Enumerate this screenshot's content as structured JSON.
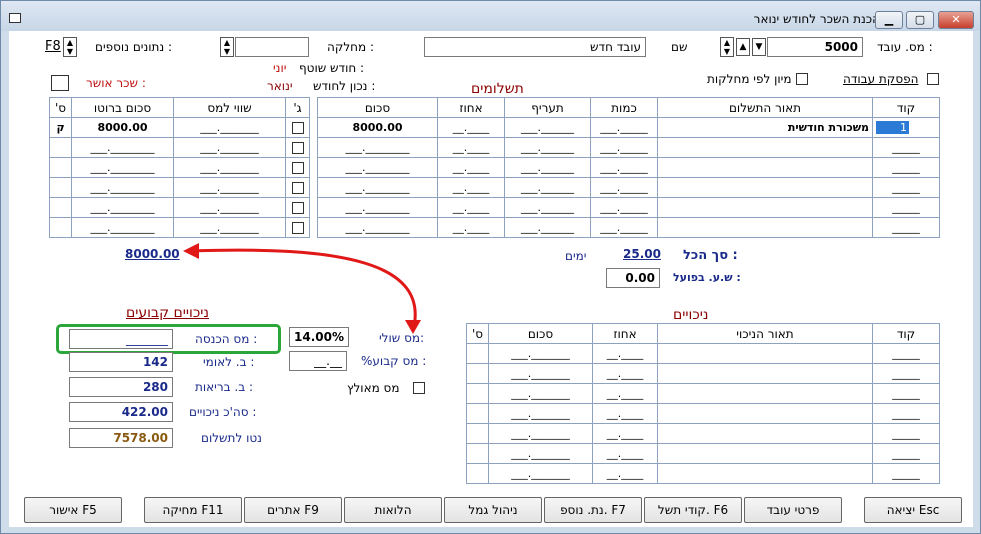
{
  "window": {
    "title": "הכנת השכר לחודש ינואר"
  },
  "header": {
    "employee_no_label": "מס. עובד :",
    "employee_no_value": "5000",
    "name_label": "שם",
    "name_value": "עובד חדש",
    "department_label": "מחלקה :",
    "department_value": "",
    "extra_data_label": "נתונים נוספים :",
    "extra_data_key": "F8",
    "current_month_label": "חודש שוטף :",
    "current_month_value": "יוני",
    "valid_month_label": "נכון לחודש :",
    "valid_month_value": "ינואר",
    "approved_salary_label": "שכר אושר :",
    "work_stop_label": "הפסקת עבודה",
    "sort_by_dept_label": "מיון לפי מחלקות"
  },
  "payments": {
    "section_title": "תשלומים",
    "columns": [
      "קוד",
      "תאור התשלום",
      "כמות",
      "תעריף",
      "אחוז",
      "סכום"
    ],
    "rows": [
      {
        "code": "1",
        "desc": "משכורת חודשית",
        "qty": "_____.___",
        "rate": "______.___",
        "pct": "____.__",
        "amount": "8000.00"
      },
      {
        "code": "_____",
        "desc": "",
        "qty": "_____.___",
        "rate": "______.___",
        "pct": "____.__",
        "amount": "________.___"
      },
      {
        "code": "_____",
        "desc": "",
        "qty": "_____.___",
        "rate": "______.___",
        "pct": "____.__",
        "amount": "________.___"
      },
      {
        "code": "_____",
        "desc": "",
        "qty": "_____.___",
        "rate": "______.___",
        "pct": "____.__",
        "amount": "________.___"
      },
      {
        "code": "_____",
        "desc": "",
        "qty": "_____.___",
        "rate": "______.___",
        "pct": "____.__",
        "amount": "________.___"
      },
      {
        "code": "_____",
        "desc": "",
        "qty": "_____.___",
        "rate": "______.___",
        "pct": "____.__",
        "amount": "________.___"
      }
    ],
    "side_columns": [
      "ג'",
      "שווי למס",
      "סכום ברוטו",
      "ס'"
    ],
    "side_rows": [
      {
        "tax_value": "_______.___",
        "gross": "8000.00",
        "s": "ק"
      },
      {
        "tax_value": "_______.___",
        "gross": "________.___",
        "s": ""
      },
      {
        "tax_value": "_______.___",
        "gross": "________.___",
        "s": ""
      },
      {
        "tax_value": "_______.___",
        "gross": "________.___",
        "s": ""
      },
      {
        "tax_value": "_______.___",
        "gross": "________.___",
        "s": ""
      },
      {
        "tax_value": "_______.___",
        "gross": "________.___",
        "s": ""
      }
    ],
    "gross_total": "8000.00",
    "total_label": "סך הכל :",
    "total_value": "25.00",
    "days_label": "ימים",
    "actual_hours_label": "ש.ע. בפועל :",
    "actual_hours_value": "0.00"
  },
  "fixed_deductions": {
    "title": "ניכויים קבועים",
    "income_tax_label": "מס הכנסה :",
    "income_tax_value": "_______",
    "national_ins_label": "ב. לאומי :",
    "national_ins_value": "142",
    "health_ins_label": "ב. בריאות :",
    "health_ins_value": "280",
    "total_deductions_label": "סה'כ ניכויים :",
    "total_deductions_value": "422.00",
    "net_label": "נטו לתשלום",
    "net_value": "7578.00"
  },
  "tax": {
    "marginal_label": "מס שולי:",
    "marginal_value": "14.00%",
    "fixed_label": "%מס קבוע :",
    "fixed_value": "__.__",
    "forced_label": "מס מאולץ"
  },
  "deductions": {
    "title": "ניכויים",
    "columns": [
      "קוד",
      "תאור הניכוי",
      "אחוז",
      "סכום",
      "ס'"
    ],
    "rows": [
      {
        "code": "_____",
        "desc": "",
        "pct": "____.__",
        "amount": "_______.___",
        "s": ""
      },
      {
        "code": "_____",
        "desc": "",
        "pct": "____.__",
        "amount": "_______.___",
        "s": ""
      },
      {
        "code": "_____",
        "desc": "",
        "pct": "____.__",
        "amount": "_______.___",
        "s": ""
      },
      {
        "code": "_____",
        "desc": "",
        "pct": "____.__",
        "amount": "_______.___",
        "s": ""
      },
      {
        "code": "_____",
        "desc": "",
        "pct": "____.__",
        "amount": "_______.___",
        "s": ""
      },
      {
        "code": "_____",
        "desc": "",
        "pct": "____.__",
        "amount": "_______.___",
        "s": ""
      },
      {
        "code": "_____",
        "desc": "",
        "pct": "____.__",
        "amount": "_______.___",
        "s": ""
      }
    ]
  },
  "buttons": {
    "exit": "יציאה Esc",
    "employee_details": "פרטי עובד",
    "payment_codes": "קודי תשל. F6",
    "extra_data": "נת. נוספ. F7",
    "provident": "ניהול גמל",
    "loans": "הלואות",
    "alerts": "אתרים F9",
    "delete": "מחיקה F11",
    "approve": "אישור F5"
  }
}
